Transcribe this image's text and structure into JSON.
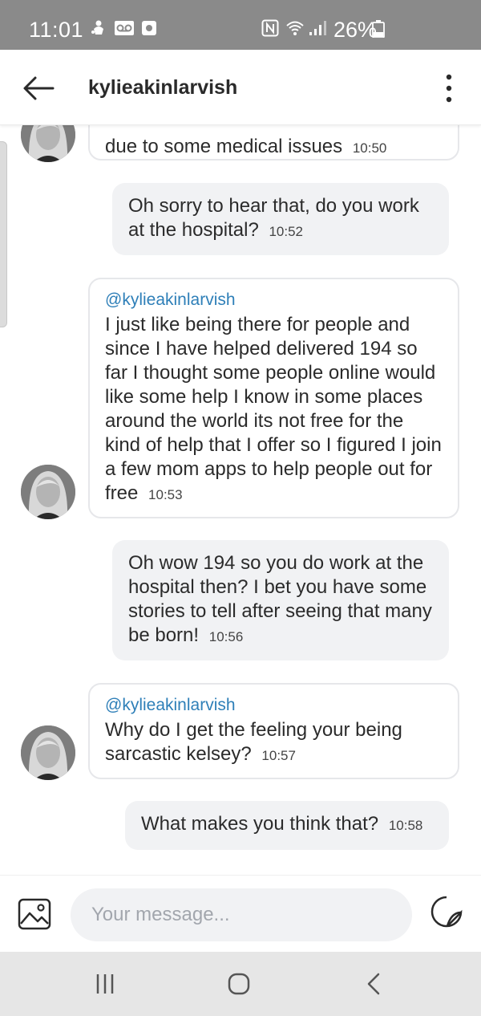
{
  "status_bar": {
    "time": "11:01",
    "battery": "26%"
  },
  "header": {
    "title": "kylieakinlarvish"
  },
  "messages": [
    {
      "text": "due to some medical issues",
      "time": "10:50"
    },
    {
      "text": "Oh sorry to hear that, do you work at the hospital?",
      "time": "10:52"
    },
    {
      "mention": "@kylieakinlarvish",
      "text": "I just like being there for people and since I have helped delivered 194 so far I thought some people online would like some help I know in some places around the world its not free for the kind of help that I offer so I figured I join a few mom apps to help people out for free",
      "time": "10:53"
    },
    {
      "text": "Oh wow 194 so you do work at the hospital then? I bet you have some stories to tell after seeing that many be born!",
      "time": "10:56"
    },
    {
      "mention": "@kylieakinlarvish",
      "text": "Why do I get the feeling your being sarcastic kelsey?",
      "time": "10:57"
    },
    {
      "text": "What makes you think that?",
      "time": "10:58"
    }
  ],
  "composer": {
    "placeholder": "Your message..."
  },
  "colors": {
    "status_bar": "#8a8a8a",
    "mention": "#2e7fb8",
    "outgoing_bubble": "#f1f2f4",
    "nav_bar": "#e6e6e6"
  }
}
